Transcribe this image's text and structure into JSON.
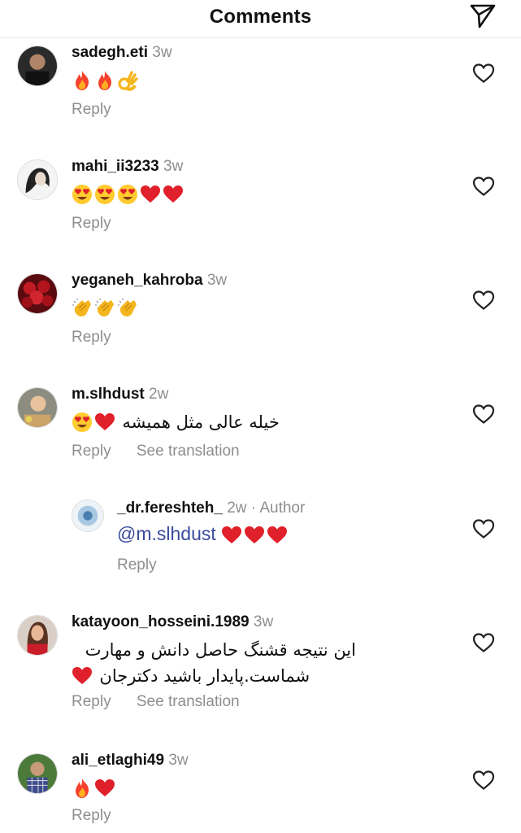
{
  "header": {
    "title": "Comments"
  },
  "reply_label": "Reply",
  "see_translation_label": "See translation",
  "comments": [
    {
      "username": "sadegh.eti",
      "time": "3w",
      "text": ""
    },
    {
      "username": "mahi_ii3233",
      "time": "3w",
      "text": ""
    },
    {
      "username": "yeganeh_kahroba",
      "time": "3w",
      "text": ""
    },
    {
      "username": "m.slhdust",
      "time": "2w",
      "text": "خیله عالی مثل همیشه"
    },
    {
      "username": "_dr.fereshteh_",
      "time": "2w",
      "author": "· Author",
      "mention": "@m.slhdust"
    },
    {
      "username": "katayoon_hosseini.1989",
      "time": "3w",
      "text_line1": "این نتیجه قشنگ حاصل دانش و مهارت",
      "text_line2": "شماست.پایدار باشید دکترجان"
    },
    {
      "username": "ali_etlaghi49",
      "time": "3w",
      "text": ""
    }
  ],
  "colors": {
    "heart_red": "#e0202a",
    "muted_text": "#8e8e8e",
    "mention": "#3b4b9d"
  }
}
